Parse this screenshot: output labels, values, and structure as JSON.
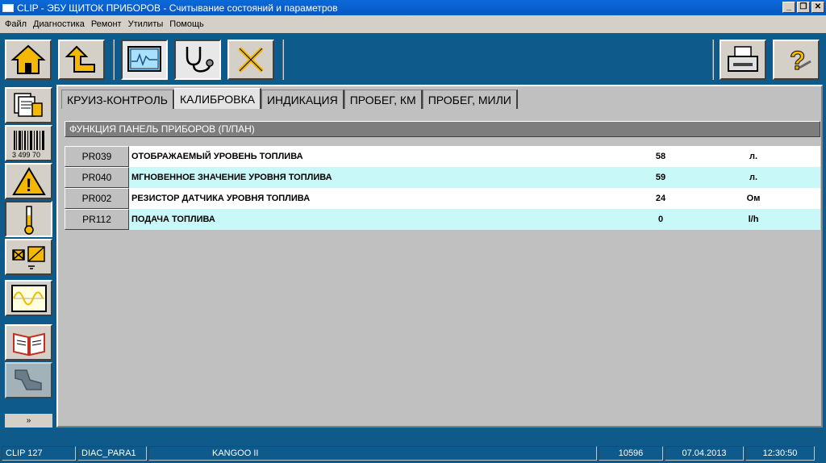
{
  "window": {
    "title": "CLIP - ЭБУ ЩИТОК ПРИБОРОВ - Считывание состояний и параметров",
    "minimize": "_",
    "maximize": "❐",
    "close": "✕"
  },
  "menu": [
    "Файл",
    "Диагностика",
    "Ремонт",
    "Утилиты",
    "Помощь"
  ],
  "toolbar": {
    "buttons": [
      "home-icon",
      "back-up-icon",
      "monitor-icon",
      "stethoscope-icon",
      "tools-icon",
      "printer-icon",
      "help-icon"
    ],
    "help_glyph": "?"
  },
  "sidebar": {
    "buttons": [
      "documents-icon",
      "barcode-icon",
      "warning-icon",
      "thermometer-icon",
      "actuator-icon",
      "oscilloscope-icon",
      "book-icon",
      "parts-icon"
    ],
    "barcode_text": "3 499 70",
    "warning_glyph": "!",
    "scroll_glyph": "»"
  },
  "tabs": [
    {
      "label": "КРУИЗ-КОНТРОЛЬ",
      "active": false
    },
    {
      "label": "КАЛИБРОВКА",
      "active": true
    },
    {
      "label": "ИНДИКАЦИЯ",
      "active": false
    },
    {
      "label": "ПРОБЕГ, КМ",
      "active": false
    },
    {
      "label": "ПРОБЕГ, МИЛИ",
      "active": false
    }
  ],
  "section": {
    "title": "ФУНКЦИЯ ПАНЕЛЬ ПРИБОРОВ (П/ПАН)"
  },
  "params": [
    {
      "code": "PR039",
      "name": "ОТОБРАЖАЕМЫЙ УРОВЕНЬ ТОПЛИВА",
      "value": "58",
      "unit": "л."
    },
    {
      "code": "PR040",
      "name": "МГНОВЕННОЕ ЗНАЧЕНИЕ УРОВНЯ ТОПЛИВА",
      "value": "59",
      "unit": "л."
    },
    {
      "code": "PR002",
      "name": "РЕЗИСТОР ДАТЧИКА УРОВНЯ ТОПЛИВА",
      "value": "24",
      "unit": "Ом"
    },
    {
      "code": "PR112",
      "name": "ПОДАЧА ТОПЛИВА",
      "value": "0",
      "unit": "l/h"
    }
  ],
  "status": {
    "clip": "CLIP 127",
    "diag": "DIAC_PARA1",
    "vehicle": "KANGOO II",
    "code": "10596",
    "date": "07.04.2013",
    "time": "12:30:50"
  },
  "colors": {
    "titlebar": "#0855c4",
    "frame": "#0e5a8a",
    "panel": "#c0c0c0",
    "row_alt": "#c8f8f8",
    "icon_yellow": "#f5b800"
  }
}
